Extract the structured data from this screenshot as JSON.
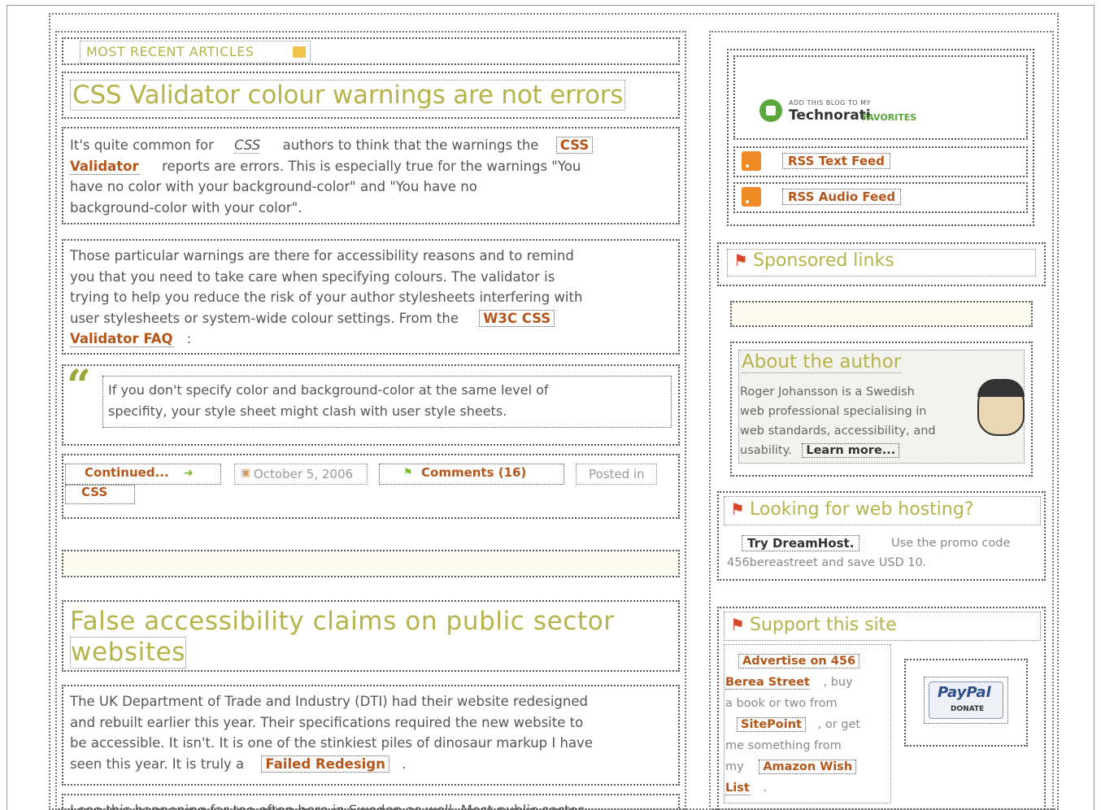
{
  "recent": {
    "label": "MOST RECENT ARTICLES",
    "icon": "rss-small-icon"
  },
  "article1": {
    "title": "CSS Validator colour warnings are not errors",
    "p1_a": "It's quite common for",
    "p1_css": "CSS",
    "p1_b": "authors to think that the warnings the",
    "p1_link1": "CSS",
    "p1_link2": "Validator",
    "p1_c": "reports are errors. This is especially true for the warnings \"You",
    "p1_d": "have no color with your background-color\" and \"You have no",
    "p1_e": "background-color with your color\".",
    "p2_l1": "Those particular warnings are there for accessibility reasons and to remind",
    "p2_l2": "you that you need to take care when specifying colours. The validator is",
    "p2_l3": "trying to help you reduce the risk of your author stylesheets interfering with",
    "p2_l4": "user stylesheets or system-wide colour settings. From the",
    "p2_link_a": "W3C CSS",
    "p2_link_b": "Validator FAQ",
    "p2_colon": ":",
    "quote_l1": "If you don't specify color and background-color at the same level of",
    "quote_l2": "specifity, your style sheet might clash with user style sheets.",
    "continued": "Continued...",
    "date": "October 5, 2006",
    "comments": "Comments (16)",
    "posted": "Posted in",
    "category": "CSS"
  },
  "article2": {
    "title_l1": "False accessibility claims on public sector",
    "title_l2": "websites",
    "p1_l1": "The UK Department of Trade and Industry (DTI) had their website redesigned",
    "p1_l2": "and rebuilt earlier this year. Their specifications required the new website to",
    "p1_l3": "be accessible. It isn't. It is one of the stinkiest piles of dinosaur markup I have",
    "p1_l4": "seen this year. It is truly a",
    "p1_link": "Failed Redesign",
    "p1_end": ".",
    "p2_l1": "I see this happening far too often here in Sweden as well. Most public sector"
  },
  "sidebar": {
    "technorati_small": "ADD THIS BLOG TO MY",
    "technorati_brand": "Technorati",
    "technorati_fav": "FAVORITES",
    "rss_text": "RSS Text Feed",
    "rss_audio": "RSS Audio Feed",
    "sponsored": "Sponsored links",
    "about_title": "About the author",
    "about_l1": "Roger Johansson is a Swedish",
    "about_l2": "web professional specialising in",
    "about_l3": "web standards, accessibility, and",
    "about_l4": "usability.",
    "learn_more": "Learn more...",
    "hosting_title": "Looking for web hosting?",
    "dreamhost": "Try DreamHost.",
    "promo_a": "Use the promo code",
    "promo_b": "456bereastreet and save USD 10.",
    "support_title": "Support this site",
    "adv_a": "Advertise on 456",
    "adv_b": "Berea Street",
    "buy": ", buy",
    "book": "a book or two from",
    "sitepoint": "SitePoint",
    "orget": ", or get",
    "something": "me something from",
    "my": "my",
    "wish_a": "Amazon Wish",
    "wish_b": "List",
    "wish_end": ".",
    "paypal": "PayPal",
    "donate": "DONATE"
  },
  "colors": {
    "link": "#b5561a",
    "heading": "#b6b34a",
    "flag": "#d8462b",
    "rss": "#f08a24"
  }
}
